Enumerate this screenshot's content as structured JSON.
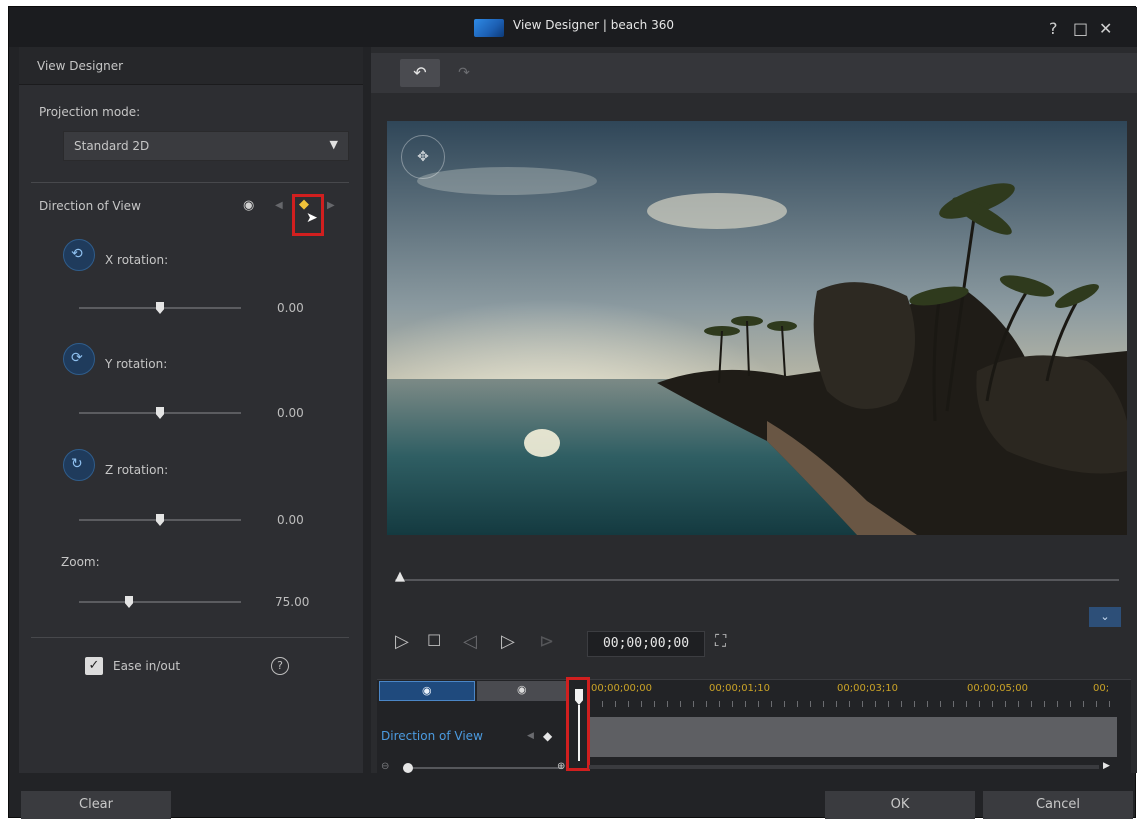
{
  "window": {
    "title": "View Designer | beach 360",
    "help_glyph": "?",
    "maximize_glyph": "□",
    "close_glyph": "✕"
  },
  "left_panel": {
    "header": "View Designer",
    "projection_mode_label": "Projection mode:",
    "projection_mode_value": "Standard 2D",
    "direction_of_view_label": "Direction of View",
    "x_rotation_label": "X rotation:",
    "x_rotation_value": "0.00",
    "x_rotation_level": 0.5,
    "y_rotation_label": "Y rotation:",
    "y_rotation_value": "0.00",
    "y_rotation_level": 0.5,
    "z_rotation_label": "Z rotation:",
    "z_rotation_value": "0.00",
    "z_rotation_level": 0.5,
    "zoom_label": "Zoom:",
    "zoom_value": "75.00",
    "ease_label": "Ease in/out",
    "ease_checked": true
  },
  "player": {
    "timecode": "00;00;00;00"
  },
  "timeline": {
    "ticks": [
      "00;00;00;00",
      "00;00;01;10",
      "00;00;03;10",
      "00;00;05;00",
      "00;"
    ],
    "track_label": "Direction of View"
  },
  "buttons": {
    "clear": "Clear",
    "ok": "OK",
    "cancel": "Cancel"
  },
  "colors": {
    "accent": "#2e6fbf",
    "highlight": "#d11f1f",
    "timeline_ticks": "#c9a227"
  },
  "icons": {
    "undo": "undo-icon",
    "redo": "redo-icon",
    "keyframe": "keyframe-diamond-icon"
  }
}
